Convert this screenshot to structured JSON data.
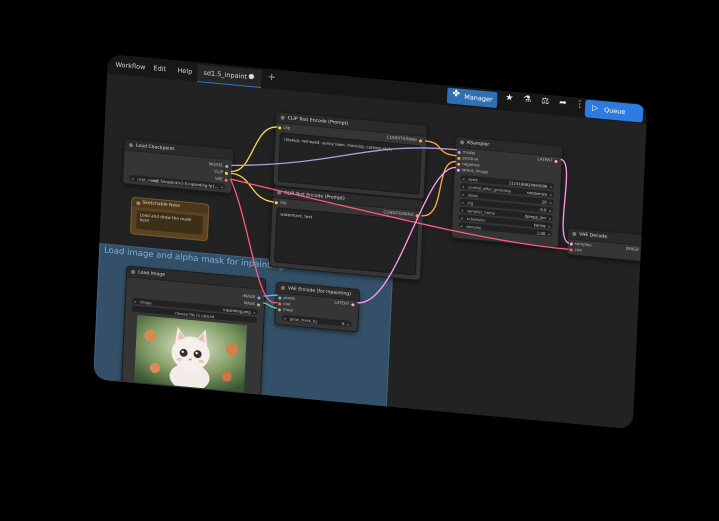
{
  "menu": {
    "workflow": "Workflow",
    "edit": "Edit",
    "help": "Help",
    "active_tab": "sd1.5_inpaint",
    "tab_modified_marker": "●",
    "add_tab": "+"
  },
  "toolbar": {
    "manager_label": "Manager",
    "queue_label": "Queue"
  },
  "nodes": {
    "clip_positive": {
      "title": "CLIP Text Encode (Prompt)",
      "input": "clip",
      "output": "CONDITIONING",
      "text": "closeup, red-eyed, sunny lawn, morning, cartoon style"
    },
    "clip_negative": {
      "title": "CLIP Text Encode (Prompt)",
      "input": "clip",
      "output": "CONDITIONING",
      "text": "watermark, text"
    },
    "load_checkpoint": {
      "title": "Load Checkpoint",
      "outputs": [
        "MODEL",
        "CLIP",
        "VAE"
      ],
      "ckpt_label": "ckpt_name",
      "ckpt_value": "sd1.5/inpaint/v1-5-inpainting.fp1..."
    },
    "ksampler": {
      "title": "KSampler",
      "inputs": [
        "model",
        "positive",
        "negative",
        "latent_image"
      ],
      "output": "LATENT",
      "widgets": [
        {
          "label": "seed",
          "value": "1115166624983696"
        },
        {
          "label": "control_after_generate",
          "value": "randomize"
        },
        {
          "label": "steps",
          "value": "20"
        },
        {
          "label": "cfg",
          "value": "8.0"
        },
        {
          "label": "sampler_name",
          "value": "dpmpp_2m"
        },
        {
          "label": "scheduler",
          "value": "karras"
        },
        {
          "label": "denoise",
          "value": "1.00"
        }
      ]
    },
    "vae_decode": {
      "title": "VAE Decode",
      "inputs": [
        "samples",
        "vae"
      ],
      "output": "IMAGE"
    },
    "note": {
      "title": "Sketchable Note",
      "text": "Load and draw the mask here"
    },
    "load_image": {
      "title": "Load Image",
      "outputs": [
        "IMAGE",
        "MASK"
      ],
      "image_label": "image",
      "image_value": "inpainting.png",
      "upload_label": "choose file to upload"
    },
    "vae_encode": {
      "title": "VAE Encode (for Inpainting)",
      "inputs": [
        "pixels",
        "vae",
        "mask"
      ],
      "output": "LATENT",
      "widget_label": "grow_mask_by",
      "widget_value": "6"
    }
  },
  "group": {
    "title": "Load image and alpha mask for inpainting"
  },
  "colors": {
    "model": "#b39ddb",
    "clip": "#ffd54f",
    "vae": "#ff5c7a",
    "conditioning": "#ffa94d",
    "latent": "#ff9ce6",
    "image": "#64b5f6",
    "mask": "#81c784",
    "accent": "#2d7be0"
  },
  "icons": [
    "puzzle-icon",
    "star-icon",
    "flask-icon",
    "scale-icon",
    "share-icon",
    "menu-icon",
    "play-icon"
  ]
}
